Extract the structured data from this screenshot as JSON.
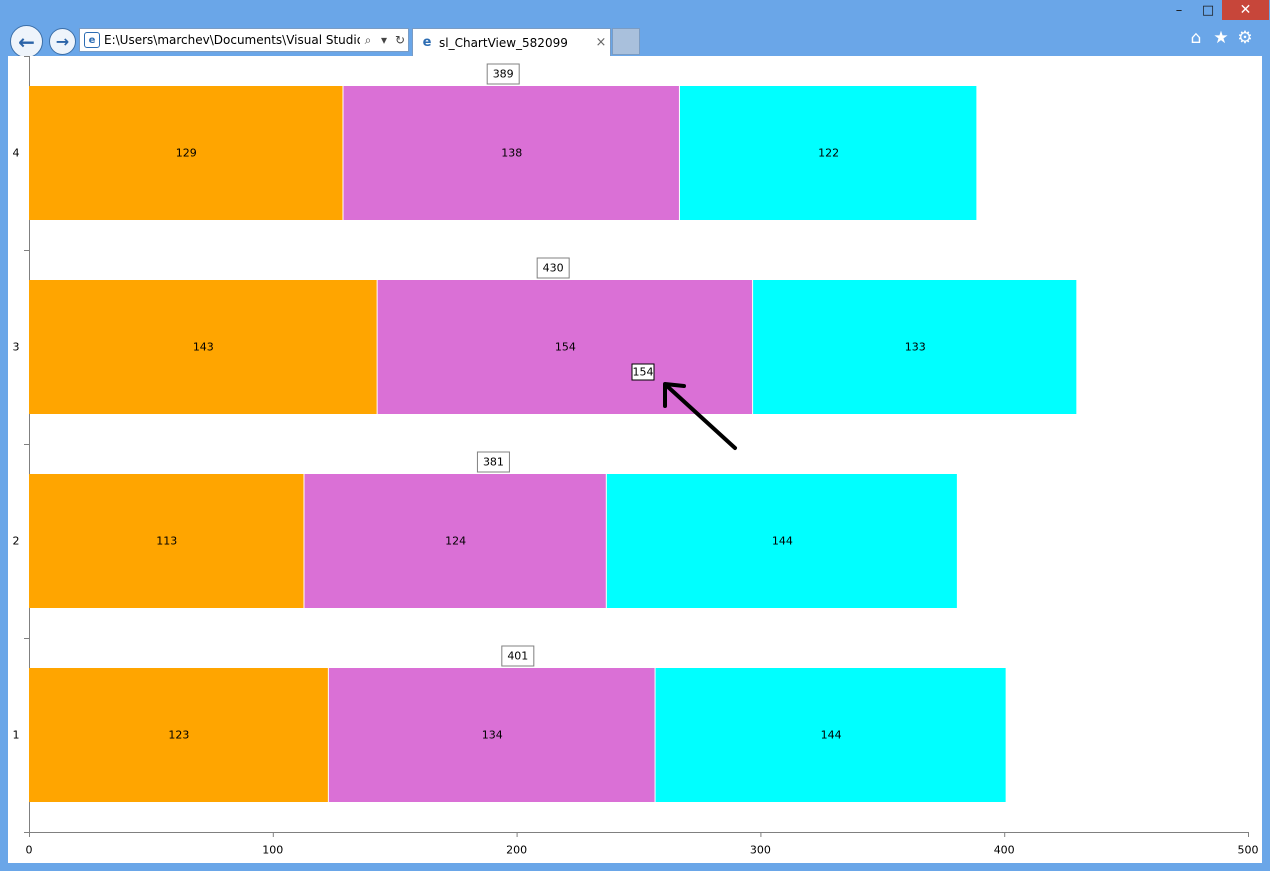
{
  "window": {
    "minimize_glyph": "–",
    "maximize_glyph": "□",
    "close_glyph": "✕"
  },
  "nav": {
    "back_glyph": "←",
    "forward_glyph": "→"
  },
  "address_bar": {
    "url": "E:\\Users\\marchev\\Documents\\Visual Studio 20",
    "page_icon_glyph": "e",
    "search_glyph": "⌕",
    "dropdown_glyph": "▾",
    "refresh_glyph": "↻"
  },
  "tab": {
    "title": "sl_ChartView_582099",
    "icon_glyph": "e",
    "close_glyph": "×"
  },
  "toolbar": {
    "home_glyph": "⌂",
    "favorites_glyph": "★",
    "tools_glyph": "⚙"
  },
  "chart_data": {
    "type": "bar",
    "orientation": "horizontal",
    "stacked": true,
    "categories": [
      "1",
      "2",
      "3",
      "4"
    ],
    "series": [
      {
        "values": [
          123,
          113,
          143,
          129
        ],
        "color": "#FFA500"
      },
      {
        "values": [
          134,
          124,
          154,
          138
        ],
        "color": "#DA70D6"
      },
      {
        "values": [
          144,
          144,
          133,
          122
        ],
        "color": "#00FFFF"
      }
    ],
    "totals": [
      401,
      381,
      430,
      389
    ],
    "xlim": [
      0,
      500
    ],
    "x_ticks": [
      "0",
      "100",
      "200",
      "300",
      "400",
      "500"
    ],
    "annotation": {
      "label": "154",
      "category": "3",
      "note": "arrow pointing to misplaced label"
    },
    "grid": false
  },
  "colors": {
    "window_frame": "#6aa6e8",
    "close_button": "#c7463a",
    "arrow": "#000000"
  }
}
